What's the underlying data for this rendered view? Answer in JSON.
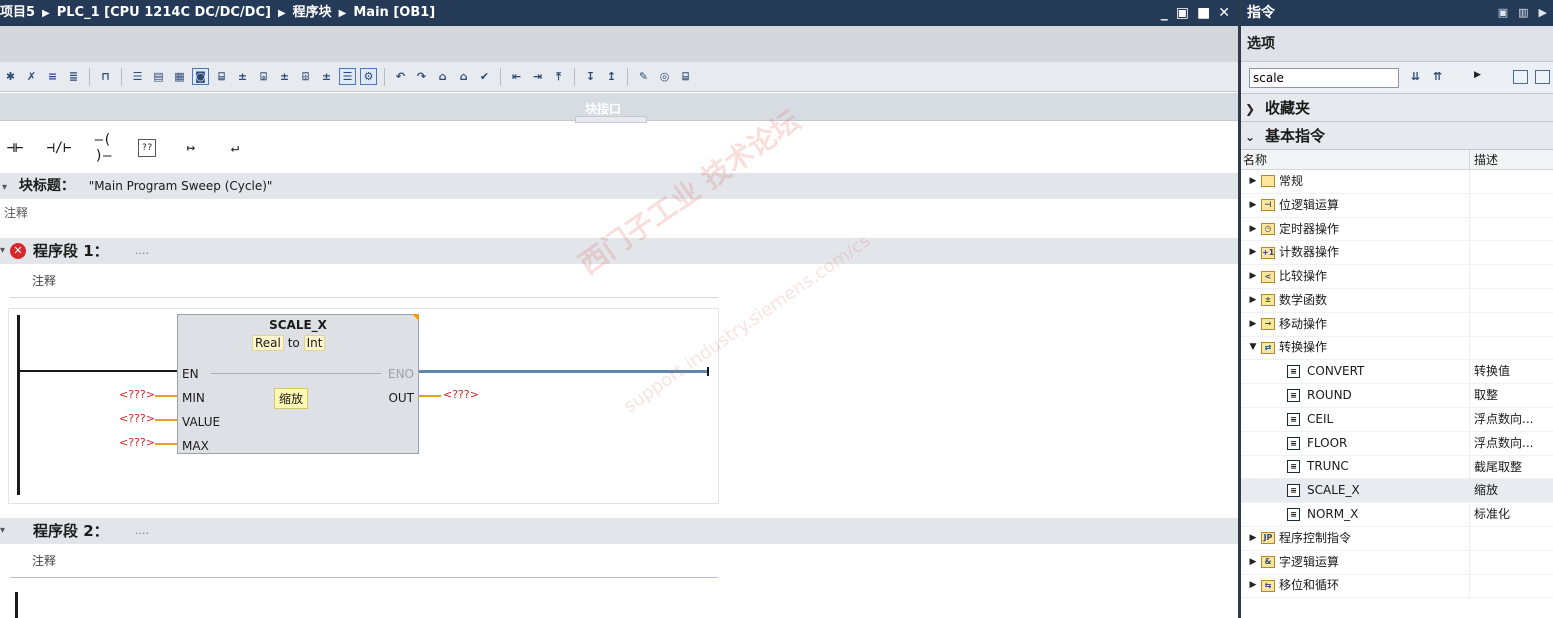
{
  "editor": {
    "breadcrumb": [
      "项目5",
      "PLC_1 [CPU 1214C DC/DC/DC]",
      "程序块",
      "Main [OB1]"
    ],
    "window_controls": [
      "_",
      "▣",
      "■",
      "✕"
    ],
    "interface_label": "块接口",
    "block_title_label": "块标题：",
    "block_title_value": "\"Main Program Sweep (Cycle)\"",
    "comment": "注释",
    "segments": [
      {
        "label": "程序段 1：",
        "dots": "....",
        "comment": "注释",
        "error": true
      },
      {
        "label": "程序段 2：",
        "dots": "....",
        "comment": "注释",
        "error": false
      }
    ],
    "function_box": {
      "name": "SCALE_X",
      "type_in": "Real",
      "type_to": "to",
      "type_out": "Int",
      "description": "缩放",
      "pins_in": [
        "EN",
        "MIN",
        "VALUE",
        "MAX"
      ],
      "pins_out": [
        "ENO",
        "OUT"
      ],
      "placeholder": "<???>"
    },
    "ladder_tools": [
      "⊣⊢",
      "⊣/⊢",
      "—( )—",
      "??",
      "↦",
      "↵"
    ],
    "watermark": "西门子工业 技术论坛",
    "watermark_url": "support.industry.siemens.com/cs"
  },
  "taskcard": {
    "title": "指令",
    "options_label": "选项",
    "search_value": "scale",
    "favorites_label": "收藏夹",
    "basic_label": "基本指令",
    "col_name": "名称",
    "col_desc": "描述",
    "rows": [
      {
        "kind": "folder",
        "icon": " ",
        "name": "常规",
        "desc": "",
        "expanded": false
      },
      {
        "kind": "folder",
        "icon": "⊣",
        "name": "位逻辑运算",
        "desc": "",
        "expanded": false
      },
      {
        "kind": "folder",
        "icon": "◷",
        "name": "定时器操作",
        "desc": "",
        "expanded": false
      },
      {
        "kind": "folder",
        "icon": "+1",
        "name": "计数器操作",
        "desc": "",
        "expanded": false
      },
      {
        "kind": "folder",
        "icon": "<",
        "name": "比较操作",
        "desc": "",
        "expanded": false
      },
      {
        "kind": "folder",
        "icon": "±",
        "name": "数学函数",
        "desc": "",
        "expanded": false
      },
      {
        "kind": "folder",
        "icon": "→",
        "name": "移动操作",
        "desc": "",
        "expanded": false
      },
      {
        "kind": "folder",
        "icon": "⇄",
        "name": "转换操作",
        "desc": "",
        "expanded": true
      },
      {
        "kind": "instr",
        "name": "CONVERT",
        "desc": "转换值"
      },
      {
        "kind": "instr",
        "name": "ROUND",
        "desc": "取整"
      },
      {
        "kind": "instr",
        "name": "CEIL",
        "desc": "浮点数向..."
      },
      {
        "kind": "instr",
        "name": "FLOOR",
        "desc": "浮点数向..."
      },
      {
        "kind": "instr",
        "name": "TRUNC",
        "desc": "截尾取整"
      },
      {
        "kind": "instr",
        "name": "SCALE_X",
        "desc": "缩放",
        "selected": true
      },
      {
        "kind": "instr",
        "name": "NORM_X",
        "desc": "标准化"
      },
      {
        "kind": "folder",
        "icon": "JP",
        "name": "程序控制指令",
        "desc": "",
        "expanded": false
      },
      {
        "kind": "folder",
        "icon": "&",
        "name": "字逻辑运算",
        "desc": "",
        "expanded": false
      },
      {
        "kind": "folder",
        "icon": "⇆",
        "name": "移位和循环",
        "desc": "",
        "expanded": false
      }
    ]
  }
}
